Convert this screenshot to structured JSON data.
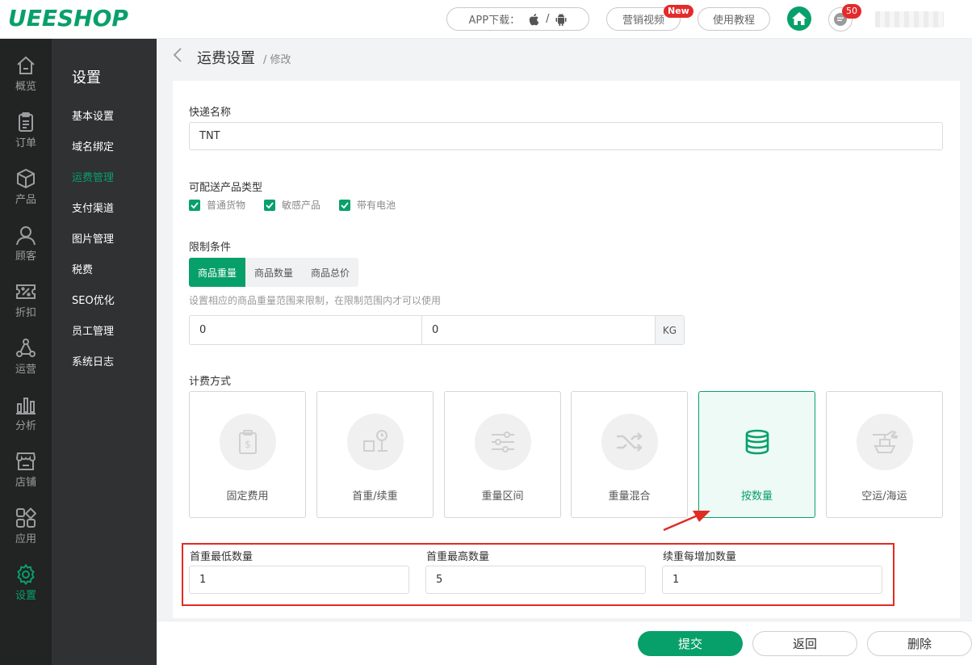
{
  "header": {
    "logo": "UEESHOP",
    "app_download": "APP下载：",
    "app_sep": "/",
    "video": "营销视频",
    "video_badge": "New",
    "tutorial": "使用教程",
    "msg_count": "50"
  },
  "rail": {
    "items": [
      "概览",
      "订单",
      "产品",
      "顾客",
      "折扣",
      "运营",
      "分析",
      "店铺",
      "应用",
      "设置"
    ]
  },
  "settings_menu": {
    "title": "设置",
    "items": [
      "基本设置",
      "域名绑定",
      "运费管理",
      "支付渠道",
      "图片管理",
      "税费",
      "SEO优化",
      "员工管理",
      "系统日志"
    ],
    "active": "运费管理"
  },
  "page": {
    "title": "运费设置",
    "sub": "/ 修改"
  },
  "form": {
    "express_label": "快递名称",
    "express_value": "TNT",
    "product_types_label": "可配送产品类型",
    "product_types": [
      "普通货物",
      "敏感产品",
      "带有电池"
    ],
    "limit_label": "限制条件",
    "limit_tabs": [
      "商品重量",
      "商品数量",
      "商品总价"
    ],
    "limit_active": "商品重量",
    "limit_hint": "设置相应的商品重量范围来限制，在限制范围内才可以使用",
    "range_min": "0",
    "range_max": "0",
    "range_unit": "KG",
    "billing_label": "计费方式",
    "billing_methods": [
      "固定费用",
      "首重/续重",
      "重量区间",
      "重量混合",
      "按数量",
      "空运/海运"
    ],
    "billing_selected": "按数量",
    "qty_first_min_label": "首重最低数量",
    "qty_first_min_value": "1",
    "qty_first_max_label": "首重最高数量",
    "qty_first_max_value": "5",
    "qty_step_label": "续重每增加数量",
    "qty_step_value": "1"
  },
  "footer": {
    "submit": "提交",
    "back": "返回",
    "delete": "删除"
  },
  "colors": {
    "brand": "#08a06a",
    "highlight": "#e22b22"
  }
}
